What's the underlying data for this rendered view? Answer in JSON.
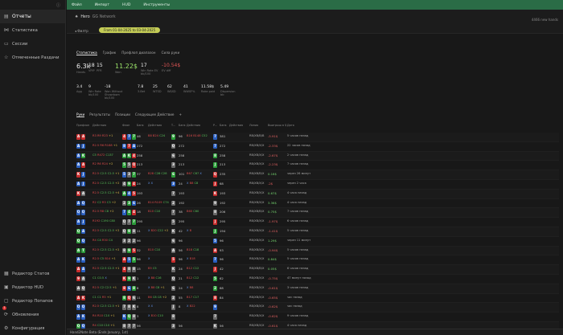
{
  "sidebar": {
    "items": [
      {
        "label": "Отчеты",
        "active": true,
        "icon": "reports-icon"
      },
      {
        "label": "Статистика",
        "icon": "stats-icon"
      },
      {
        "label": "Сессии",
        "icon": "sessions-icon"
      },
      {
        "label": "Отмеченные Раздачи",
        "icon": "star-icon"
      }
    ],
    "bottom": [
      {
        "label": "Редактор Статов",
        "icon": "grid-icon"
      },
      {
        "label": "Редактор HUD",
        "icon": "hud-icon"
      },
      {
        "label": "Редактор Попапов",
        "icon": "popup-icon"
      },
      {
        "label": "Обновления",
        "icon": "update-icon",
        "badge": "1"
      },
      {
        "label": "Конфигурация",
        "icon": "gear-icon"
      }
    ]
  },
  "menu": [
    "Файл",
    "Импорт",
    "HUD",
    "Инструменты"
  ],
  "header": {
    "hero": "Hero",
    "site": "GG Network",
    "right": "4466 new hands",
    "back": "Филтр",
    "date_range": "From 01-04-2025 to 03-04-2025"
  },
  "tabs1": [
    "Статистика",
    "График",
    "Префлоп диапазон",
    "Сила руки"
  ],
  "kpis": [
    {
      "v": "6.3k",
      "l": "Hands",
      "big": true
    },
    {
      "v": "18",
      "l": "VPIP"
    },
    {
      "v": "15",
      "l": "PFR"
    },
    {
      "v": "11.22$",
      "l": "Won",
      "big": true,
      "color": "green"
    },
    {
      "v": "17",
      "l": "Win Rate EV\nbb/100"
    },
    {
      "v": "-10.54$",
      "l": "EV diff",
      "color": "red"
    }
  ],
  "kpis2": [
    {
      "v": "3.4",
      "l": "Agg"
    },
    {
      "v": "9",
      "l": "Win Rate\nbb/100"
    },
    {
      "v": "-18",
      "l": "Won Without\nShowdown\nbb/100"
    },
    {
      "v": "7.8",
      "l": "3-Bet"
    },
    {
      "v": "25",
      "l": "WTSD"
    },
    {
      "v": "62",
      "l": "W$SD"
    },
    {
      "v": "41",
      "l": "WWSF%"
    },
    {
      "v": "11.58$",
      "l": "Rake paid"
    },
    {
      "v": "5.49",
      "l": "Dispersion\nbb"
    }
  ],
  "tabs2": [
    "Руки",
    "Результаты",
    "Позиции",
    "Следующее Действие",
    "+"
  ],
  "columns": [
    "Префлоп",
    "Действия",
    "Флоп",
    "Банк",
    "Действия",
    "Т...",
    "Банк",
    "Действия",
    "Р...",
    "Банк",
    "Действия",
    "Линия",
    "Выигрыш в $",
    "Дата"
  ],
  "hands": [
    {
      "h": [
        [
          "A",
          "red"
        ],
        [
          "A",
          "red"
        ]
      ],
      "pf": "R3 R9 R23 +1",
      "flop": [
        [
          "4",
          "red"
        ],
        [
          "7",
          "blue"
        ],
        [
          "7",
          "green"
        ]
      ],
      "fpot": "46",
      "fact": "B8 B24 C24",
      "turn": [
        [
          "9",
          "green"
        ]
      ],
      "tpot": "96",
      "tact": "B16 B148 C52",
      "river": [
        [
          "7",
          "blue"
        ]
      ],
      "rpot": "381",
      "line": "RB/XB/B/B",
      "res": "-5.91$",
      "pos": false,
      "date": "5 часов назад"
    },
    {
      "h": [
        [
          "A",
          "blue"
        ],
        [
          "J",
          "blue"
        ]
      ],
      "pf": "R2.5 R6 R168 +1",
      "flop": [
        [
          "8",
          "blue"
        ],
        [
          "7",
          "red"
        ],
        [
          "A",
          "blue"
        ]
      ],
      "fpot": "272",
      "fact": "",
      "turn": [
        [
          "Q",
          "gray"
        ]
      ],
      "tpot": "272",
      "tact": "",
      "river": [
        [
          "7",
          "blue"
        ]
      ],
      "rpot": "272",
      "line": "RB/XB/X/X",
      "res": "-2.33$",
      "pos": false,
      "date": "22 часов назад"
    },
    {
      "h": [
        [
          "A",
          "blue"
        ],
        [
          "K",
          "green"
        ]
      ],
      "pf": "C5 R472 C137",
      "flop": [
        [
          "A",
          "green"
        ],
        [
          "K",
          "green"
        ],
        [
          "4",
          "red"
        ]
      ],
      "fpot": "258",
      "fact": "",
      "turn": [
        [
          "6",
          "gray"
        ]
      ],
      "tpot": "258",
      "tact": "",
      "river": [
        [
          "8",
          "green"
        ]
      ],
      "rpot": "258",
      "line": "RB/XB/X/X",
      "res": "-2.67$",
      "pos": false,
      "date": "2 часов назад"
    },
    {
      "h": [
        [
          "A",
          "blue"
        ],
        [
          "A",
          "red"
        ]
      ],
      "pf": "R2 R6 R24 +2",
      "flop": [
        [
          "5",
          "green"
        ],
        [
          "5",
          "gray"
        ],
        [
          "Q",
          "red"
        ]
      ],
      "fpot": "213",
      "fact": "",
      "turn": [
        [
          "3",
          "gray"
        ]
      ],
      "tpot": "213",
      "tact": "",
      "river": [
        [
          "J",
          "green"
        ]
      ],
      "rpot": "213",
      "line": "RB/XB/X/X",
      "res": "-2.23$",
      "pos": false,
      "date": "7 часов назад"
    },
    {
      "h": [
        [
          "K",
          "red"
        ],
        [
          "J",
          "blue"
        ]
      ],
      "pf": "R2.5 C2.5 C2.5 +1",
      "flop": [
        [
          "5",
          "blue"
        ],
        [
          "3",
          "gray"
        ],
        [
          "7",
          "green"
        ]
      ],
      "fpot": "37",
      "fact": "B28 C28 C28",
      "turn": [
        [
          "6",
          "green"
        ]
      ],
      "tpot": "101",
      "tact": "B67 C67 X",
      "river": [
        [
          "Q",
          "red"
        ]
      ],
      "rpot": "235",
      "line": "RB/XB/B/X",
      "res": "0.16$",
      "pos": true,
      "date": "через 26 минут"
    },
    {
      "h": [
        [
          "A",
          "blue"
        ],
        [
          "J",
          "blue"
        ]
      ],
      "pf": "R2.5 C2.5 C2.5 +2",
      "flop": [
        [
          "4",
          "gray"
        ],
        [
          "9",
          "green"
        ],
        [
          "4",
          "red"
        ]
      ],
      "fpot": "24",
      "fact": "X X",
      "turn": [
        [
          "3",
          "blue"
        ]
      ],
      "tpot": "24",
      "tact": "X B8 C8",
      "river": [
        [
          "J",
          "red"
        ]
      ],
      "rpot": "68",
      "line": "RB/XB/X/X",
      "res": "-2$",
      "pos": false,
      "date": "через 2 часа"
    },
    {
      "h": [
        [
          "K",
          "red"
        ],
        [
          "A",
          "gray"
        ]
      ],
      "pf": "R2.5 C2.5 C2.5 +4",
      "flop": [
        [
          "A",
          "green"
        ],
        [
          "4",
          "blue"
        ],
        [
          "5",
          "red"
        ]
      ],
      "fpot": "193",
      "fact": "",
      "turn": [
        [
          "7",
          "gray"
        ]
      ],
      "tpot": "193",
      "tact": "",
      "river": [
        [
          "K",
          "red"
        ]
      ],
      "rpot": "193",
      "line": "RB/XB/X/X",
      "res": "0.67$",
      "pos": true,
      "date": "4 часа назад"
    },
    {
      "h": [
        [
          "A",
          "blue"
        ],
        [
          "Q",
          "blue"
        ]
      ],
      "pf": "R2 C2 R3 C3 +2",
      "flop": [
        [
          "2",
          "gray"
        ],
        [
          "3",
          "green"
        ],
        [
          "6",
          "blue"
        ]
      ],
      "fpot": "26",
      "fact": "B14 R109 C74",
      "turn": [
        [
          "2",
          "gray"
        ]
      ],
      "tpot": "192",
      "tact": "",
      "river": [
        [
          "9",
          "gray"
        ]
      ],
      "rpot": "192",
      "line": "RB/XB/X/X",
      "res": "3.36$",
      "pos": true,
      "date": "4 часа назад"
    },
    {
      "h": [
        [
          "Q",
          "blue"
        ],
        [
          "Q",
          "blue"
        ]
      ],
      "pf": "R2.5 R8 C8 +2",
      "flop": [
        [
          "7",
          "blue"
        ],
        [
          "4",
          "green"
        ],
        [
          "4",
          "red"
        ]
      ],
      "fpot": "18",
      "fact": "B10 C10",
      "turn": [
        [
          "7",
          "gray"
        ]
      ],
      "tpot": "38",
      "tact": "B60 C60",
      "river": [
        [
          "8",
          "gray"
        ]
      ],
      "rpot": "206",
      "line": "RB/XB/B/X",
      "res": "0.75$",
      "pos": true,
      "date": "7 часов назад"
    },
    {
      "h": [
        [
          "A",
          "blue"
        ],
        [
          "J",
          "blue"
        ]
      ],
      "pf": "R192 C190 C80",
      "flop": [
        [
          "Q",
          "gray"
        ],
        [
          "7",
          "gray"
        ],
        [
          "7",
          "green"
        ]
      ],
      "fpot": "295",
      "fact": "",
      "turn": [
        [
          "5",
          "gray"
        ]
      ],
      "tpot": "295",
      "tact": "",
      "river": [
        [
          "J",
          "red"
        ]
      ],
      "rpot": "295",
      "line": "RB/XB/X/X",
      "res": "-1.97$",
      "pos": false,
      "date": "6 часов назад"
    },
    {
      "h": [
        [
          "Q",
          "green"
        ],
        [
          "A",
          "blue"
        ]
      ],
      "pf": "R2.5 C2.5 C2.5 +2",
      "flop": [
        [
          "Q",
          "gray"
        ],
        [
          "9",
          "green"
        ],
        [
          "8",
          "gray"
        ]
      ],
      "fpot": "11",
      "fact": "X B20 C22 +2",
      "turn": [
        [
          "K",
          "gray"
        ]
      ],
      "tpot": "42",
      "tact": "X B",
      "river": [
        [
          "J",
          "green"
        ]
      ],
      "rpot": "194",
      "line": "RB/XB/X/X",
      "res": "-1.41$",
      "pos": false,
      "date": "5 часов назад"
    },
    {
      "h": [
        [
          "Q",
          "green"
        ],
        [
          "Q",
          "blue"
        ]
      ],
      "pf": "R4 C4 R30 C4",
      "flop": [
        [
          "3",
          "gray"
        ],
        [
          "2",
          "gray"
        ],
        [
          "2",
          "gray"
        ]
      ],
      "fpot": "96",
      "fact": "",
      "turn": [
        [
          "6",
          "gray"
        ]
      ],
      "tpot": "96",
      "tact": "",
      "river": [
        [
          "5",
          "blue"
        ]
      ],
      "rpot": "96",
      "line": "RB/XB/X/X",
      "res": "1.29$",
      "pos": true,
      "date": "через 11 минут"
    },
    {
      "h": [
        [
          "A",
          "green"
        ],
        [
          "T",
          "green"
        ]
      ],
      "pf": "R2.5 C2.5 C2.5 +2",
      "flop": [
        [
          "8",
          "gray"
        ],
        [
          "9",
          "green"
        ],
        [
          "5",
          "red"
        ]
      ],
      "fpot": "32",
      "fact": "B10 C10",
      "turn": [
        [
          "A",
          "gray"
        ]
      ],
      "tpot": "56",
      "tact": "B18 C18",
      "river": [
        [
          "A",
          "red"
        ]
      ],
      "rpot": "93",
      "line": "RB/XB/X/X",
      "res": "-0.94$",
      "pos": false,
      "date": "5 часов назад"
    },
    {
      "h": [
        [
          "A",
          "blue"
        ],
        [
          "K",
          "blue"
        ]
      ],
      "pf": "R2.5 C5 B14 +1",
      "flop": [
        [
          "A",
          "red"
        ],
        [
          "5",
          "blue"
        ],
        [
          "5",
          "green"
        ]
      ],
      "fpot": "96",
      "fact": "X",
      "turn": [
        [
          "5",
          "red"
        ]
      ],
      "tpot": "96",
      "tact": "X B18",
      "river": [
        [
          "7",
          "blue"
        ]
      ],
      "rpot": "96",
      "line": "RB/XB/X/X",
      "res": "0.84$",
      "pos": true,
      "date": "5 часов назад"
    },
    {
      "h": [
        [
          "A",
          "red"
        ],
        [
          "A",
          "blue"
        ]
      ],
      "pf": "R2.5 C2.5 C2.5 +1",
      "flop": [
        [
          "4",
          "red"
        ],
        [
          "8",
          "gray"
        ],
        [
          "8",
          "gray"
        ]
      ],
      "fpot": "15",
      "fact": "B5 C5",
      "turn": [
        [
          "K",
          "gray"
        ]
      ],
      "tpot": "24",
      "tact": "B12 C12",
      "river": [
        [
          "J",
          "red"
        ]
      ],
      "rpot": "42",
      "line": "RB/XB/B/X",
      "res": "0.05$",
      "pos": true,
      "date": "6 часов назад"
    },
    {
      "h": [
        [
          "9",
          "red"
        ],
        [
          "A",
          "gray"
        ]
      ],
      "pf": "C1 C0.5 X",
      "flop": [
        [
          "K",
          "red"
        ],
        [
          "9",
          "green"
        ],
        [
          "K",
          "gray"
        ]
      ],
      "fpot": "1",
      "fact": "X B8 C16",
      "turn": [
        [
          "Q",
          "gray"
        ]
      ],
      "tpot": "21",
      "tact": "B12 C12",
      "river": [
        [
          "5",
          "green"
        ]
      ],
      "rpot": "62",
      "line": "RB/XB/X/X",
      "res": "-0.75$",
      "pos": false,
      "date": "47 минут назад"
    },
    {
      "h": [
        [
          "A",
          "gray"
        ],
        [
          "Q",
          "gray"
        ]
      ],
      "pf": "R2.5 C2 C2.5 +1",
      "flop": [
        [
          "8",
          "red"
        ],
        [
          "6",
          "blue"
        ],
        [
          "8",
          "green"
        ]
      ],
      "fpot": "8",
      "fact": "X B8 C8 +1",
      "turn": [
        [
          "6",
          "gray"
        ]
      ],
      "tpot": "24",
      "tact": "X B8",
      "river": [
        [
          "2",
          "green"
        ]
      ],
      "rpot": "68",
      "line": "RB/XB/X/X",
      "res": "-0.61$",
      "pos": false,
      "date": "3 часов назад"
    },
    {
      "h": [
        [
          "A",
          "red"
        ],
        [
          "K",
          "red"
        ]
      ],
      "pf": "C1 C1 R5 +1",
      "flop": [
        [
          "8",
          "green"
        ],
        [
          "Q",
          "red"
        ],
        [
          "6",
          "gray"
        ]
      ],
      "fpot": "11",
      "fact": "B6 C8 C8 +2",
      "turn": [
        [
          "2",
          "gray"
        ]
      ],
      "tpot": "55",
      "tact": "B17 C17",
      "river": [
        [
          "8",
          "red"
        ]
      ],
      "rpot": "84",
      "line": "RB/XB/X/X",
      "res": "-0.65$",
      "pos": false,
      "date": "час назад"
    },
    {
      "h": [
        [
          "Q",
          "blue"
        ],
        [
          "Q",
          "blue"
        ]
      ],
      "pf": "R2.5 C2.5 C2.5 +1",
      "flop": [
        [
          "7",
          "gray"
        ],
        [
          "8",
          "gray"
        ],
        [
          "K",
          "gray"
        ]
      ],
      "fpot": "8",
      "fact": "X X",
      "turn": [
        [
          "J",
          "gray"
        ]
      ],
      "tpot": "8",
      "tact": "X B22",
      "river": [
        [
          "9",
          "blue"
        ]
      ],
      "rpot": "",
      "line": "RB/XB/X/X",
      "res": "-0.62$",
      "pos": false,
      "date": "час назад"
    },
    {
      "h": [
        [
          "A",
          "blue"
        ],
        [
          "K",
          "blue"
        ]
      ],
      "pf": "R4 R10 C10 +1",
      "flop": [
        [
          "K",
          "blue"
        ],
        [
          "Q",
          "green"
        ],
        [
          "8",
          "gray"
        ]
      ],
      "fpot": "3",
      "fact": "X B10 C10",
      "turn": [
        [
          "8",
          "gray"
        ]
      ],
      "tpot": "",
      "tact": "",
      "river": [
        [
          "7",
          "gray"
        ]
      ],
      "rpot": "",
      "line": "RB/XB/X/X",
      "res": "-0.62$",
      "pos": false,
      "date": "9 часов назад"
    },
    {
      "h": [
        [
          "Q",
          "green"
        ],
        [
          "Q",
          "blue"
        ]
      ],
      "pf": "R4 C10 C10 +1",
      "flop": [
        [
          "8",
          "gray"
        ],
        [
          "7",
          "gray"
        ],
        [
          "7",
          "gray"
        ]
      ],
      "fpot": "56",
      "fact": "",
      "turn": [
        [
          "3",
          "gray"
        ]
      ],
      "tpot": "56",
      "tact": "",
      "river": [
        [
          "K",
          "gray"
        ]
      ],
      "rpot": "56",
      "line": "RB/XB/X/X",
      "res": "-0.61$",
      "pos": false,
      "date": "4 часа назад"
    }
  ],
  "status": "Hand2Note Beta (Ends January, 1st)"
}
